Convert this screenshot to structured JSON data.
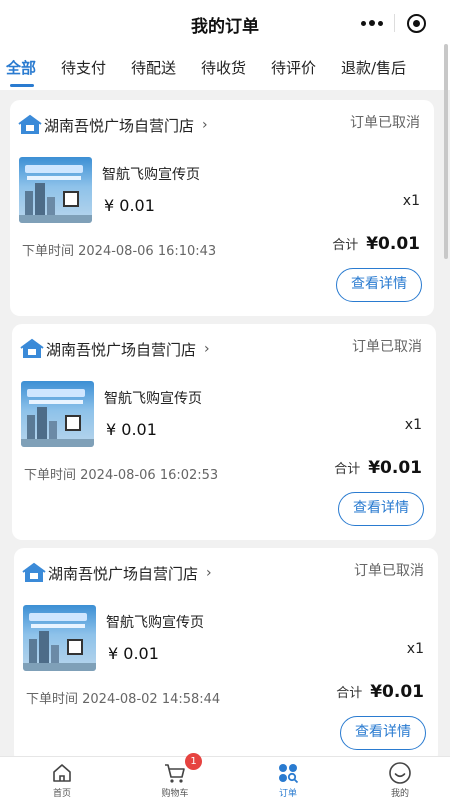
{
  "header": {
    "title": "我的订单"
  },
  "tabs": [
    {
      "label": "全部",
      "active": true
    },
    {
      "label": "待支付"
    },
    {
      "label": "待配送"
    },
    {
      "label": "待收货"
    },
    {
      "label": "待评价"
    },
    {
      "label": "退款/售后"
    }
  ],
  "orders": [
    {
      "store": "湖南吾悦广场自营门店",
      "status": "订单已取消",
      "product": "智航飞购宣传页",
      "price": "¥ 0.01",
      "qty": "x1",
      "time": "下单时间 2024-08-06 16:10:43",
      "total_label": "合计",
      "total": "¥0.01",
      "button": "查看详情"
    },
    {
      "store": "湖南吾悦广场自营门店",
      "status": "订单已取消",
      "product": "智航飞购宣传页",
      "price": "¥ 0.01",
      "qty": "x1",
      "time": "下单时间 2024-08-06 16:02:53",
      "total_label": "合计",
      "total": "¥0.01",
      "button": "查看详情"
    },
    {
      "store": "湖南吾悦广场自营门店",
      "status": "订单已取消",
      "product": "智航飞购宣传页",
      "price": "¥ 0.01",
      "qty": "x1",
      "time": "下单时间 2024-08-02 14:58:44",
      "total_label": "合计",
      "total": "¥0.01",
      "button": "查看详情"
    }
  ],
  "bottom_nav": [
    {
      "label": "首页",
      "icon": "home-icon"
    },
    {
      "label": "购物车",
      "icon": "cart-icon",
      "badge": "1"
    },
    {
      "label": "订单",
      "icon": "orders-icon",
      "active": true
    },
    {
      "label": "我的",
      "icon": "profile-icon"
    }
  ],
  "colors": {
    "accent": "#2a7bd0",
    "badge": "#e64340"
  }
}
